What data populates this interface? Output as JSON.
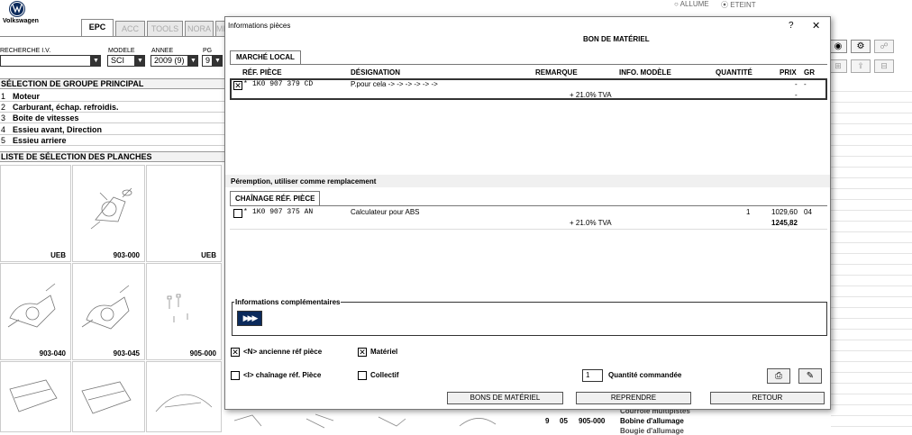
{
  "brand": {
    "name": "Volkswagen"
  },
  "status": {
    "allume": "ALLUME",
    "eteint": "ETEINT"
  },
  "tabs": [
    "EPC",
    "ACC",
    "TOOLS",
    "NORA",
    "MMM"
  ],
  "fields": {
    "vin_label": "RECHERCHE I.V.",
    "vin_value": "",
    "model_label": "MODELE",
    "model_value": "SCI",
    "year_label": "ANNEE",
    "year_value": "2009 (9)",
    "pg_label": "PG",
    "pg_value": "9"
  },
  "groups": {
    "header": "SÉLECTION DE GROUPE PRINCIPAL",
    "items": [
      {
        "num": "1",
        "label": "Moteur"
      },
      {
        "num": "2",
        "label": "Carburant, échap. refroidis."
      },
      {
        "num": "3",
        "label": "Boite de vitesses"
      },
      {
        "num": "4",
        "label": "Essieu avant, Direction"
      },
      {
        "num": "5",
        "label": "Essieu arriere"
      }
    ]
  },
  "plates": {
    "header": "LISTE DE SÉLECTION DES PLANCHES",
    "row1": [
      "",
      "UEB",
      "903-000",
      "UEB"
    ],
    "row2": [
      "903-040",
      "903-045",
      "905-000"
    ],
    "row3": [
      "",
      "",
      ""
    ]
  },
  "right_list": {
    "partial": "Courroie multipistes",
    "row": {
      "a": "9",
      "b": "05",
      "c": "905-000",
      "desc": "Bobine d'allumage"
    },
    "cut": "Bougie d'allumage"
  },
  "dialog": {
    "title": "Informations pièces",
    "help": "?",
    "close": "✕",
    "header": "BON DE MATÉRIEL",
    "market_tab": "MARCHÉ LOCAL",
    "columns": {
      "ref": "RÉF. PIÈCE",
      "designation": "DÉSIGNATION",
      "remarque": "REMARQUE",
      "info": "INFO. MODÈLE",
      "quantite": "QUANTITÉ",
      "prix": "PRIX",
      "gr": "GR"
    },
    "part": {
      "star": "*",
      "ref": "1K0 907 379 CD",
      "designation": "P.pour cela -> -> -> -> -> ->",
      "tva": "+ 21.0% TVA",
      "price": "-",
      "gr": "-",
      "price_tva": "-"
    },
    "supersede_label": "Péremption, utiliser comme remplacement",
    "chain_tab": "CHAÎNAGE RÉF. PIÈCE",
    "chain_part": {
      "star": "*",
      "ref": "1K0 907 375 AN",
      "designation": "Calculateur pour ABS",
      "qty": "1",
      "price": "1029,60",
      "gr": "04",
      "tva": "+ 21.0% TVA",
      "price_tva": "1245,82"
    },
    "info_comp": "Informations complémentaires",
    "opt_ancienne": "<N> ancienne réf pièce",
    "opt_materiel": "Matériel",
    "opt_chainage": "<I> chaînage réf. Pièce",
    "opt_collectif": "Collectif",
    "qty_value": "1",
    "qty_label": "Quantité commandée",
    "btn_bons": "BONS DE MATÉRIEL",
    "btn_reprendre": "REPRENDRE",
    "btn_retour": "RETOUR"
  }
}
